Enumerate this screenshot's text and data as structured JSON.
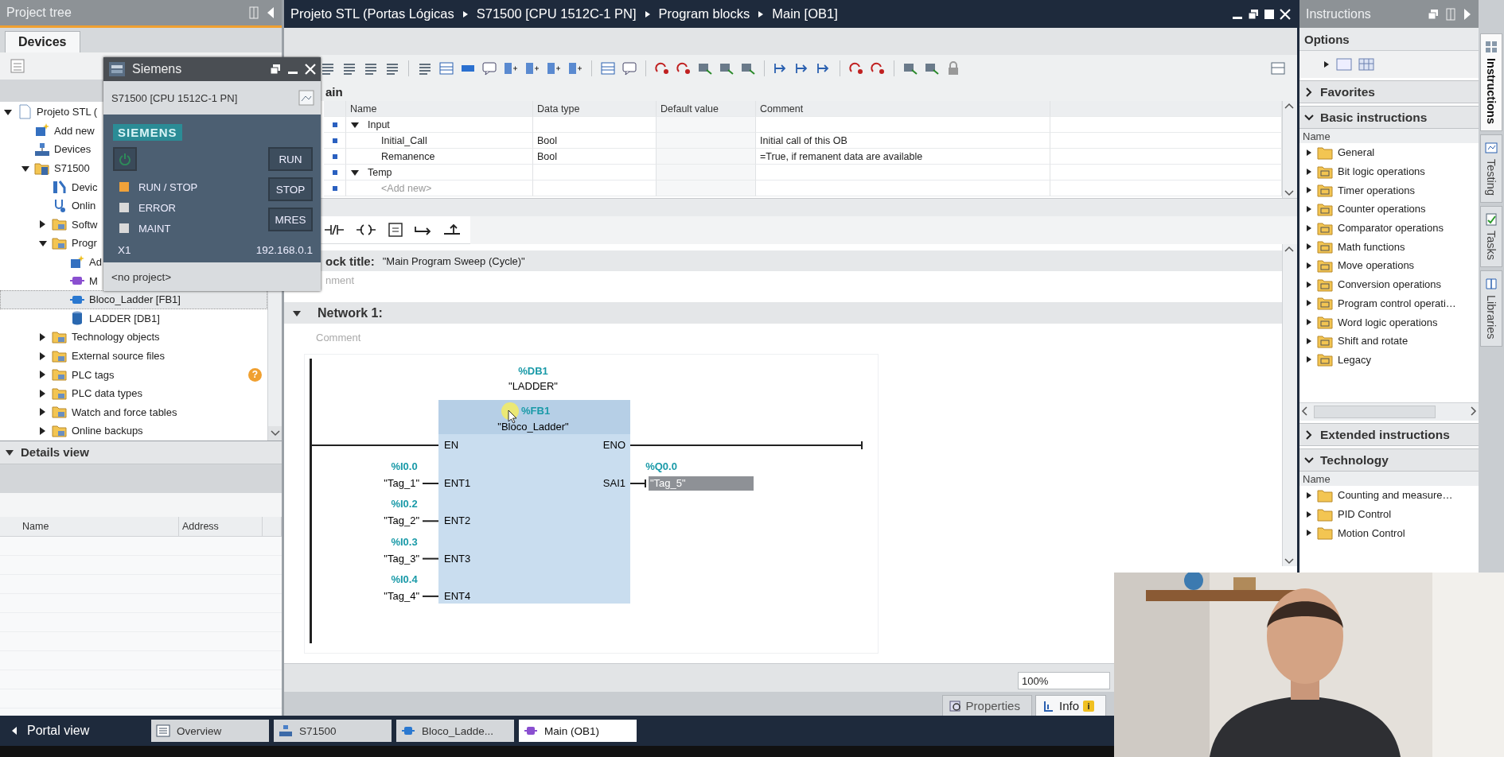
{
  "project_tree": {
    "title": "Project tree",
    "tabs": [
      {
        "label": "Devices",
        "selected": true
      }
    ],
    "items": [
      {
        "label": "Projeto STL (",
        "kind": "project",
        "expanded": true,
        "selected": false,
        "children": [
          {
            "label": "Add new",
            "kind": "add",
            "selected": false
          },
          {
            "label": "Devices",
            "kind": "network",
            "selected": false
          },
          {
            "label": "S71500",
            "kind": "plc",
            "expanded": true,
            "selected": false,
            "children": [
              {
                "label": "Devic",
                "kind": "config",
                "selected": false
              },
              {
                "label": "Onlin",
                "kind": "diagnostic",
                "selected": false
              },
              {
                "label": "Softw",
                "kind": "folder",
                "expanded": false,
                "selected": false
              },
              {
                "label": "Progr",
                "kind": "folder",
                "expanded": true,
                "selected": false,
                "children": [
                  {
                    "label": "Ad",
                    "kind": "add",
                    "selected": false
                  },
                  {
                    "label": "M",
                    "kind": "ob",
                    "selected": false
                  },
                  {
                    "label": "Bloco_Ladder [FB1]",
                    "kind": "fb",
                    "selected": true
                  },
                  {
                    "label": "LADDER [DB1]",
                    "kind": "db",
                    "selected": false
                  }
                ]
              },
              {
                "label": "Technology objects",
                "kind": "folder",
                "expanded": false,
                "selected": false
              },
              {
                "label": "External source files",
                "kind": "folder",
                "expanded": false,
                "selected": false
              },
              {
                "label": "PLC tags",
                "kind": "folder",
                "expanded": false,
                "selected": false,
                "badge": "?"
              },
              {
                "label": "PLC data types",
                "kind": "folder",
                "expanded": false,
                "selected": false
              },
              {
                "label": "Watch and force tables",
                "kind": "folder",
                "expanded": false,
                "selected": false
              },
              {
                "label": "Online backups",
                "kind": "folder",
                "expanded": false,
                "selected": false
              }
            ]
          }
        ]
      }
    ]
  },
  "details_view": {
    "title": "Details view",
    "expanded": true,
    "columns": [
      "Name",
      "Address"
    ]
  },
  "simulator": {
    "title": "Siemens",
    "device": "S71500 [CPU 1512C-1 PN]",
    "brand": "SIEMENS",
    "leds": [
      {
        "label": "RUN / STOP",
        "color": "#f0a23a"
      },
      {
        "label": "ERROR",
        "color": "#d9d9d9"
      },
      {
        "label": "MAINT",
        "color": "#d9d9d9"
      }
    ],
    "buttons": [
      "RUN",
      "STOP",
      "MRES"
    ],
    "interface": "X1",
    "ip_address": "192.168.0.1",
    "project": "<no project>"
  },
  "editor": {
    "breadcrumbs": [
      "Projeto STL (Portas Lógicas",
      "S71500 [CPU 1512C-1 PN]",
      "Program blocks",
      "Main [OB1]"
    ],
    "interface": {
      "title": "ain",
      "columns": [
        "Name",
        "Data type",
        "Default value",
        "Comment"
      ],
      "rows": [
        {
          "kind": "section",
          "name": "Input",
          "expanded": true
        },
        {
          "kind": "param",
          "name": "Initial_Call",
          "data_type": "Bool",
          "comment": "Initial call of this OB"
        },
        {
          "kind": "param",
          "name": "Remanence",
          "data_type": "Bool",
          "comment": "=True, if remanent data are available"
        },
        {
          "kind": "section",
          "name": "Temp",
          "expanded": true
        },
        {
          "kind": "add",
          "name": "<Add new>"
        }
      ]
    },
    "block_title": {
      "label": "ock title:",
      "value": "\"Main Program Sweep (Cycle)\"",
      "comment": "nment"
    },
    "network": {
      "title": "Network 1:",
      "expanded": true,
      "comment": "Comment"
    },
    "diagram": {
      "instance_address": "%DB1",
      "instance_name": "\"LADDER\"",
      "block_address": "%FB1",
      "block_name": "\"Bloco_Ladder\"",
      "enable_in": "EN",
      "enable_out": "ENO",
      "inputs": [
        {
          "address": "%I0.0",
          "tag": "\"Tag_1\"",
          "pin": "ENT1",
          "selected": false
        },
        {
          "address": "%I0.2",
          "tag": "\"Tag_2\"",
          "pin": "ENT2",
          "selected": false
        },
        {
          "address": "%I0.3",
          "tag": "\"Tag_3\"",
          "pin": "ENT3",
          "selected": false
        },
        {
          "address": "%I0.4",
          "tag": "\"Tag_4\"",
          "pin": "ENT4",
          "selected": false
        }
      ],
      "outputs": [
        {
          "address": "%Q0.0",
          "tag": "\"Tag_5\"",
          "pin": "SAI1",
          "selected": true
        }
      ]
    },
    "zoom": "100%",
    "inspector_tabs": [
      {
        "label": "Properties",
        "selected": false
      },
      {
        "label": "Info",
        "selected": true,
        "badge": "i"
      }
    ]
  },
  "instructions": {
    "title": "Instructions",
    "options": "Options",
    "sections": [
      {
        "title": "Favorites",
        "expanded": false
      },
      {
        "title": "Basic instructions",
        "expanded": true,
        "column": "Name",
        "items": [
          "General",
          "Bit logic operations",
          "Timer operations",
          "Counter operations",
          "Comparator operations",
          "Math functions",
          "Move operations",
          "Conversion operations",
          "Program control operati…",
          "Word logic operations",
          "Shift and rotate",
          "Legacy"
        ]
      },
      {
        "title": "Extended instructions",
        "expanded": false
      },
      {
        "title": "Technology",
        "expanded": true,
        "column": "Name",
        "items": [
          "Counting and measure…",
          "PID Control",
          "Motion Control"
        ]
      }
    ]
  },
  "side_tabs": [
    {
      "label": "Instructions",
      "selected": true
    },
    {
      "label": "Testing",
      "selected": false
    },
    {
      "label": "Tasks",
      "selected": false
    },
    {
      "label": "Libraries",
      "selected": false
    }
  ],
  "taskbar": {
    "portal": "Portal view",
    "items": [
      {
        "label": "Overview",
        "kind": "overview",
        "selected": false
      },
      {
        "label": "S71500",
        "kind": "device",
        "selected": false
      },
      {
        "label": "Bloco_Ladde...",
        "kind": "fb",
        "selected": false
      },
      {
        "label": "Main (OB1)",
        "kind": "ob",
        "selected": true
      }
    ]
  }
}
